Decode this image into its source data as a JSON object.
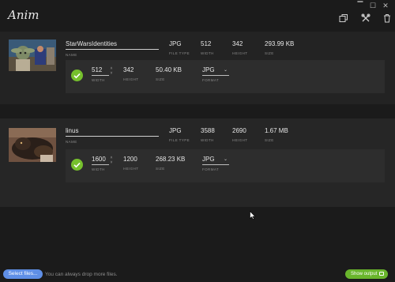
{
  "app": {
    "title": "Anim"
  },
  "window_controls": {
    "minimize": "▔",
    "maximize": "☐",
    "close": "✕"
  },
  "toolbar": {
    "icons": [
      "duplicate-icon",
      "tools-icon",
      "trash-icon"
    ]
  },
  "images": [
    {
      "name": "StarWarsIdentities",
      "file_type": "JPG",
      "width": "512",
      "height": "342",
      "size": "293.99 KB",
      "labels": {
        "name": "NAME",
        "file_type": "FILE TYPE",
        "width": "WIDTH",
        "height": "HEIGHT",
        "size": "SIZE"
      },
      "output": {
        "width": "512",
        "height": "342",
        "size": "50.40 KB",
        "format": "JPG",
        "labels": {
          "width": "WIDTH",
          "height": "HEIGHT",
          "size": "SIZE",
          "format": "FORMAT"
        }
      }
    },
    {
      "name": "linus",
      "file_type": "JPG",
      "width": "3588",
      "height": "2690",
      "size": "1.67 MB",
      "labels": {
        "name": "NAME",
        "file_type": "FILE TYPE",
        "width": "WIDTH",
        "height": "HEIGHT",
        "size": "SIZE"
      },
      "output": {
        "width": "1600",
        "height": "1200",
        "size": "268.23 KB",
        "format": "JPG",
        "labels": {
          "width": "WIDTH",
          "height": "HEIGHT",
          "size": "SIZE",
          "format": "FORMAT"
        }
      }
    }
  ],
  "footer": {
    "select_label": "Select files...",
    "hint": "You can always drop more files.",
    "show_output_label": "Show output"
  },
  "colors": {
    "accent_blue": "#5f8fe6",
    "accent_green": "#69b52c",
    "background": "#1b1b1b",
    "card": "#232323",
    "panel": "#2d2d2d"
  }
}
